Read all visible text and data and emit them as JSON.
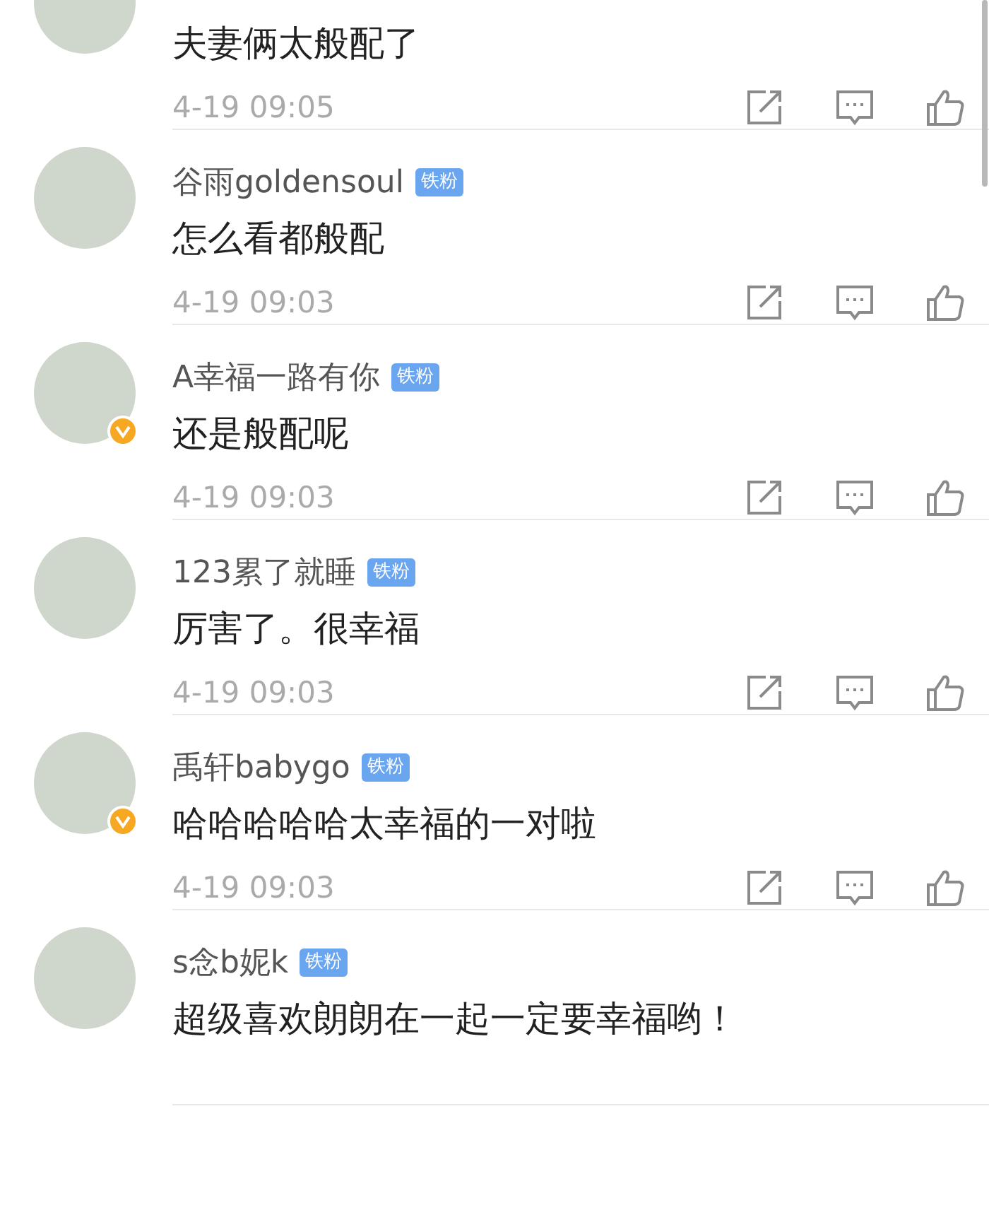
{
  "comments": [
    {
      "verified": false,
      "text": "夫妻俩太般配了",
      "time": "4-19 09:05"
    },
    {
      "name": "谷雨goldensoul",
      "badge": "铁粉",
      "verified": false,
      "text": "怎么看都般配",
      "time": "4-19 09:03"
    },
    {
      "name": "A幸福一路有你",
      "badge": "铁粉",
      "verified": true,
      "text": "还是般配呢",
      "time": "4-19 09:03"
    },
    {
      "name": "123累了就睡",
      "badge": "铁粉",
      "verified": false,
      "text": "厉害了。很幸福",
      "time": "4-19 09:03"
    },
    {
      "name": "禹轩babygo",
      "badge": "铁粉",
      "verified": true,
      "text": "哈哈哈哈哈太幸福的一对啦",
      "time": "4-19 09:03"
    },
    {
      "name": "s念b妮k",
      "badge": "铁粉",
      "verified": false,
      "text": "超级喜欢朗朗在一起一定要幸福哟！"
    }
  ]
}
